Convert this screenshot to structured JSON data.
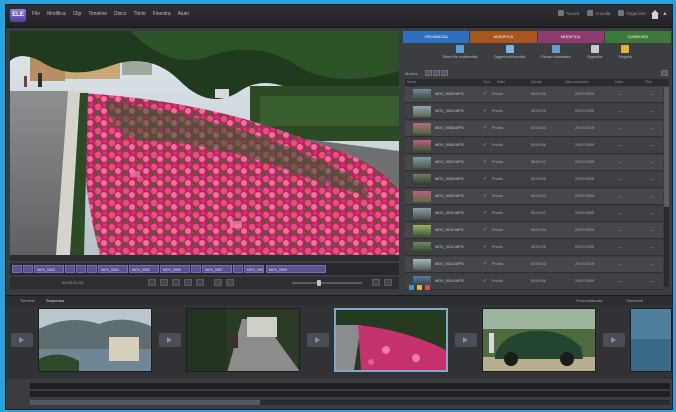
{
  "app": {
    "icon_text": "ELE"
  },
  "menu": [
    "File",
    "Modifica",
    "Clip",
    "Timeline",
    "Disco",
    "Titolo",
    "Finestra",
    "Aiuto"
  ],
  "toolbar": {
    "undo_label": "Ann.",
    "items": [
      "Nuovo",
      "Annulla",
      "Organizer"
    ]
  },
  "tabs": [
    {
      "label": "ORGANIZZA",
      "color": "#2f6fbf"
    },
    {
      "label": "MODIFICA",
      "color": "#a8561d"
    },
    {
      "label": "MODIFICA",
      "color": "#8d3b70"
    },
    {
      "label": "CONDIVIDI",
      "color": "#3d7a3a"
    }
  ],
  "actions": [
    {
      "label": "Ottieni file multimediali",
      "color": "#5aa0d9"
    },
    {
      "label": "Oggetti multimediali",
      "color": "#7fb4e0"
    },
    {
      "label": "Filmato istantaneo",
      "color": "#6c9bd0"
    },
    {
      "label": "Organizer",
      "color": "#c8ccd2"
    },
    {
      "label": "Progetto",
      "color": "#e6b23a"
    }
  ],
  "filter": {
    "label": "Mostra:",
    "scope": "Tutti"
  },
  "list_header": [
    "Nome",
    "Tipo",
    "Stato",
    "Durata",
    "Data creazione",
    "Inizio",
    "Fine"
  ],
  "rows": [
    {
      "name": "MOV_0003.MPG",
      "status": "Pronto",
      "duration": "00:00:05",
      "date": "20/07/2009",
      "c1": "—",
      "c2": "—"
    },
    {
      "name": "MOV_0004.MPG",
      "status": "Pronto",
      "duration": "00:00:03",
      "date": "20/07/2009",
      "c1": "—",
      "c2": "—"
    },
    {
      "name": "MOV_0005.MPG",
      "status": "Pronto",
      "duration": "00:00:04",
      "date": "20/07/2009",
      "c1": "—",
      "c2": "—"
    },
    {
      "name": "MOV_0006.MPG",
      "status": "Pronto",
      "duration": "00:00:06",
      "date": "20/07/2009",
      "c1": "—",
      "c2": "—"
    },
    {
      "name": "MOV_0007.MPG",
      "status": "Pronto",
      "duration": "00:00:02",
      "date": "20/07/2009",
      "c1": "—",
      "c2": "—"
    },
    {
      "name": "MOV_0008.MPG",
      "status": "Pronto",
      "duration": "00:00:05",
      "date": "20/07/2009",
      "c1": "—",
      "c2": "—"
    },
    {
      "name": "MOV_0009.MPG",
      "status": "Pronto",
      "duration": "00:00:03",
      "date": "20/07/2009",
      "c1": "—",
      "c2": "—"
    },
    {
      "name": "MOV_0010.MPG",
      "status": "Pronto",
      "duration": "00:00:07",
      "date": "20/07/2009",
      "c1": "—",
      "c2": "—"
    },
    {
      "name": "MOV_0011.MPG",
      "status": "Pronto",
      "duration": "00:00:04",
      "date": "20/07/2009",
      "c1": "—",
      "c2": "—"
    },
    {
      "name": "MOV_0012.MPG",
      "status": "Pronto",
      "duration": "00:00:05",
      "date": "20/07/2009",
      "c1": "—",
      "c2": "—"
    },
    {
      "name": "MOV_0013.MPG",
      "status": "Pronto",
      "duration": "00:00:03",
      "date": "20/07/2009",
      "c1": "—",
      "c2": "—"
    },
    {
      "name": "MOV_0014.MPG",
      "status": "Pronto",
      "duration": "00:00:06",
      "date": "20/07/2009",
      "c1": "—",
      "c2": "—"
    }
  ],
  "clips": [
    "MOV_0003",
    "MOV_0004",
    "MOV_0005",
    "MOV_0006",
    "MOV_0007",
    "MOV_0008",
    "MOV_0009",
    "MOV_0010"
  ],
  "timecode": "00:00:01:04",
  "storyboard": {
    "tabs": [
      "Timeline",
      "Sequenza"
    ],
    "right": [
      "Personalizzato",
      "Strumenti"
    ]
  }
}
